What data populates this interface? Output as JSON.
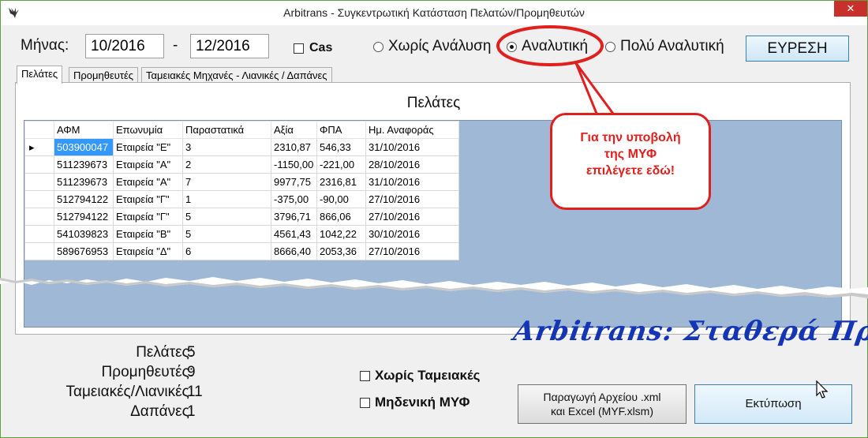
{
  "window": {
    "title": "Arbitrans - Συγκεντρωτική Κατάσταση Πελατών/Προμηθευτών",
    "close_glyph": "✕"
  },
  "filters": {
    "month_label": "Μήνας:",
    "from_month": "10/2016",
    "separator": "-",
    "to_month": "12/2016",
    "cas_label": "Cas",
    "cas_checked": false,
    "analysis_options": [
      {
        "label": "Χωρίς Ανάλυση",
        "selected": false
      },
      {
        "label": "Αναλυτική",
        "selected": true
      },
      {
        "label": "Πολύ Αναλυτική",
        "selected": false
      }
    ],
    "search_label": "ΕΥΡΕΣΗ"
  },
  "tabs": [
    {
      "label": "Πελάτες",
      "active": true
    },
    {
      "label": "Προμηθευτές",
      "active": false
    },
    {
      "label": "Ταμειακές Μηχανές - Λιανικές / Δαπάνες",
      "active": false
    }
  ],
  "panel": {
    "title": "Πελάτες",
    "columns": [
      "ΑΦΜ",
      "Επωνυμία",
      "Παραστατικά",
      "Αξία",
      "ΦΠΑ",
      "Ημ. Αναφοράς"
    ],
    "rows": [
      [
        "503900047",
        "Εταιρεία \"Ε\"",
        "3",
        "2310,87",
        "546,33",
        "31/10/2016"
      ],
      [
        "511239673",
        "Εταιρεία \"Α\"",
        "2",
        "-1150,00",
        "-221,00",
        "28/10/2016"
      ],
      [
        "511239673",
        "Εταιρεία \"Α\"",
        "7",
        "9977,75",
        "2316,81",
        "31/10/2016"
      ],
      [
        "512794122",
        "Εταιρεία \"Γ\"",
        "1",
        "-375,00",
        "-90,00",
        "27/10/2016"
      ],
      [
        "512794122",
        "Εταιρεία \"Γ\"",
        "5",
        "3796,71",
        "866,06",
        "27/10/2016"
      ],
      [
        "541039823",
        "Εταιρεία \"Β\"",
        "5",
        "4561,43",
        "1042,22",
        "30/10/2016"
      ],
      [
        "589676953",
        "Εταιρεία \"Δ\"",
        "6",
        "8666,40",
        "2053,36",
        "27/10/2016"
      ]
    ],
    "current_row_marker": "▸"
  },
  "callout": {
    "lines": [
      "Για την υποβολή",
      "της  ΜΥΦ",
      "επιλέγετε εδώ!"
    ],
    "color": "#e0201e"
  },
  "stats": [
    {
      "label": "Πελάτες:",
      "value": "5"
    },
    {
      "label": "Προμηθευτές:",
      "value": "9"
    },
    {
      "label": "Ταμειακές/Λιανικές:",
      "value": "11"
    },
    {
      "label": "Δαπάνες:",
      "value": "1"
    }
  ],
  "options": {
    "no_registers_label": "Χωρίς Ταμειακές",
    "no_registers_checked": false,
    "zero_myf_label": "Μηδενική ΜΥΦ",
    "zero_myf_checked": false
  },
  "slogan": "Arbitrans: Σταθερά Πρωτοπόροι!",
  "actions": {
    "export_line1": "Παραγωγή Αρχείου .xml",
    "export_line2": "και Excel (MYF.xlsm)",
    "print_label": "Εκτύπωση"
  },
  "colors": {
    "accent_green": "#5fa043",
    "grid_background": "#9fb8d5",
    "selection": "#3399ff",
    "slogan": "#1436b4",
    "close": "#c7302b"
  }
}
